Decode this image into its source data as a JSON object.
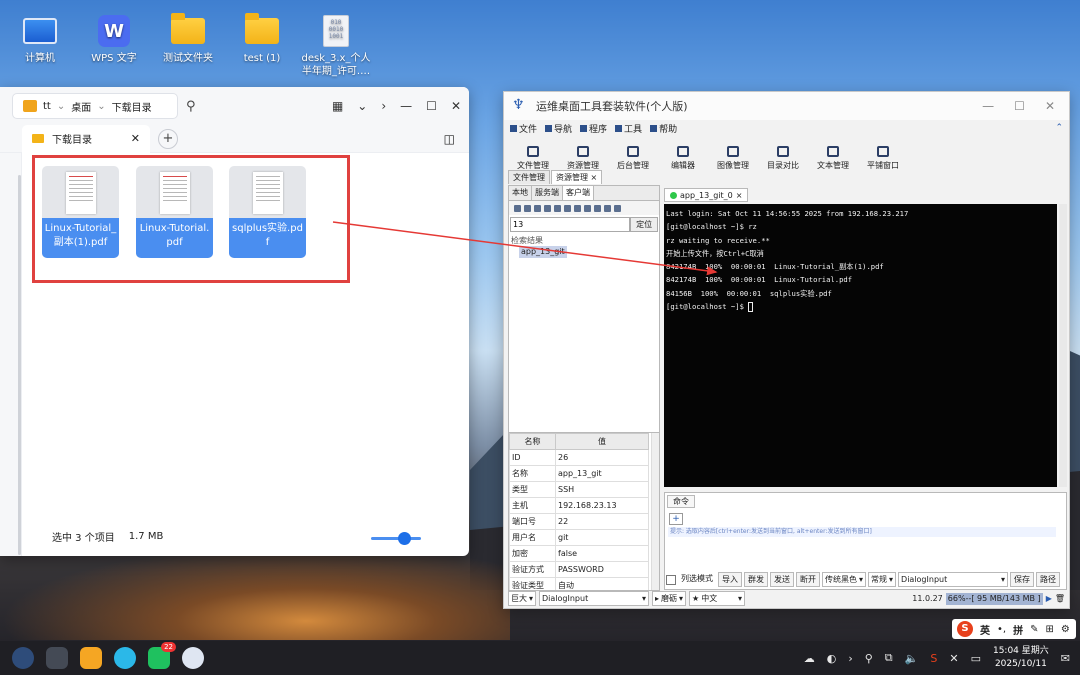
{
  "desktop": {
    "icons": [
      {
        "label": "计算机",
        "icon": "computer-icon"
      },
      {
        "label": "WPS 文字",
        "icon": "wps-writer-icon"
      },
      {
        "label": "测试文件夹",
        "icon": "folder-icon"
      },
      {
        "label": "test (1)",
        "icon": "folder-icon"
      },
      {
        "label": "desk_3.x_个人半年期_许可.…",
        "icon": "binary-file-icon"
      }
    ]
  },
  "file_manager": {
    "breadcrumb": [
      "tt",
      "桌面",
      "下载目录"
    ],
    "tab_label": "下载目录",
    "files": [
      {
        "name": "Linux-Tutorial_副本(1).pdf"
      },
      {
        "name": "Linux-Tutorial.pdf"
      },
      {
        "name": "sqlplus实验.pdf"
      }
    ],
    "status_selected": "选中 3 个项目",
    "status_size": "1.7 MB",
    "zoom_level": 0.4
  },
  "ops": {
    "title": "运维桌面工具套装软件(个人版)",
    "menu": [
      "文件",
      "导航",
      "程序",
      "工具",
      "帮助"
    ],
    "toolbar": [
      "文件管理",
      "资源管理",
      "后台管理",
      "编辑器",
      "图像管理",
      "目录对比",
      "文本管理",
      "平铺窗口"
    ],
    "subtabs": [
      "文件管理",
      "资源管理"
    ],
    "left_tabs": [
      "本地",
      "服务端",
      "客户端"
    ],
    "search_value": "13",
    "search_button": "定位",
    "tree_root": "检索结果",
    "tree_item": "app_13_git",
    "props_header": [
      "名称",
      "值"
    ],
    "props": [
      [
        "ID",
        "26"
      ],
      [
        "名称",
        "app_13_git"
      ],
      [
        "类型",
        "SSH"
      ],
      [
        "主机",
        "192.168.23.13"
      ],
      [
        "端口号",
        "22"
      ],
      [
        "用户名",
        "git"
      ],
      [
        "加密",
        "false"
      ],
      [
        "验证方式",
        "PASSWORD"
      ],
      [
        "验证类型",
        "自动"
      ]
    ],
    "term_tab": "app_13_git_0",
    "terminal_lines": [
      "Last login: Sat Oct 11 14:56:55 2025 from 192.168.23.217",
      "[git@localhost ~]$ rz",
      "rz waiting to receive.**",
      "开始上传文件，按Ctrl+C取消",
      "842174B  100%  00:00:01  Linux-Tutorial_副本(1).pdf",
      "842174B  100%  00:00:01  Linux-Tutorial.pdf",
      "84156B  100%  00:00:01  sqlplus实验.pdf",
      "[git@localhost ~]$ "
    ],
    "cmd_tab": "命令",
    "cmd_hint": "提示: 选取内容后[ctrl+enter:发送到当前窗口, alt+enter:发送到所有窗口]",
    "cmd_buttons": [
      "列选模式",
      "导入",
      "群发",
      "发送",
      "断开"
    ],
    "cmd_selects": [
      "传统黑色",
      "常规",
      "DialogInput"
    ],
    "cmd_buttons2": [
      "保存",
      "路径"
    ],
    "status": {
      "size": "巨大",
      "font": "DialogInput",
      "theme": "磨砺",
      "lang": "中文",
      "version": "11.0.27",
      "memory": "66%--[ 95 MB/143 MB ]"
    }
  },
  "taskbar": {
    "badge": "22",
    "time": "15:04 星期六",
    "date": "2025/10/11"
  },
  "ime": {
    "lang": "英",
    "mode": "拼"
  }
}
